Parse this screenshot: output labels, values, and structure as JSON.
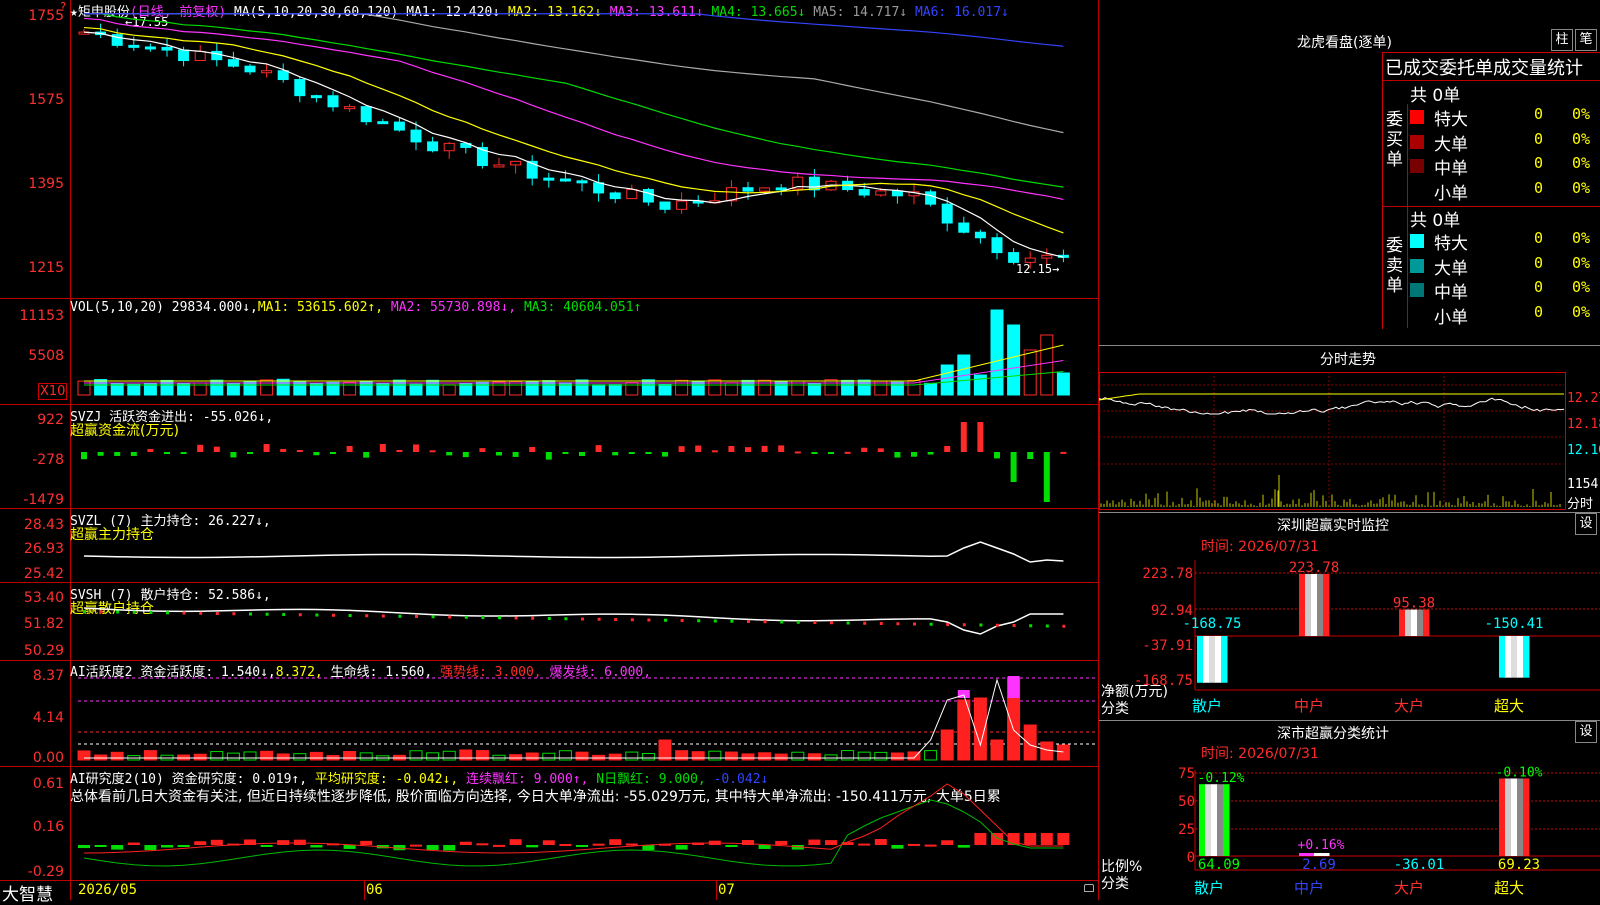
{
  "main_chart": {
    "marker": "?",
    "title_star": "★",
    "stock_name": "矩申股份",
    "period": "(日线, 前复权)",
    "ma_header": "MA(5,10,20,30,60,120)",
    "ma1": "MA1: 12.420↓",
    "ma2": "MA2: 13.162↓",
    "ma3": "MA3: 13.611↓",
    "ma4": "MA4: 13.665↓",
    "ma5": "MA5: 14.717↓",
    "ma6": "MA6: 16.017↓",
    "y_labels": [
      "1755",
      "1575",
      "1395",
      "1215"
    ],
    "high_label": "←17.55",
    "low_label": "12.15→",
    "colors": {
      "up": "#ff2a2a",
      "down": "#00ffff",
      "ma1": "#ffffff",
      "ma2": "#ffff00",
      "ma3": "#ff33ff",
      "ma4": "#00dd00",
      "ma5": "#aaaaaa",
      "ma6": "#3344ff"
    }
  },
  "vol_panel": {
    "header": "VOL(5,10,20)",
    "value": "29834.000↓,",
    "ma1": "MA1: 53615.602↑,",
    "ma2": "MA2: 55730.898↓,",
    "ma3": "MA3: 40604.051↑",
    "y_labels": [
      "11153",
      "5508"
    ],
    "unit": "X10"
  },
  "svzj_panel": {
    "header": "SVZJ",
    "line1": "活跃资金进出: -55.026↓,",
    "line2": "超赢资金流(万元)",
    "y_labels": [
      "922",
      "-278",
      "-1479"
    ]
  },
  "svzl_panel": {
    "header": "SVZL (7)",
    "line1": "主力持仓: 26.227↓,",
    "line2": "超赢主力持仓",
    "y_labels": [
      "28.43",
      "26.93",
      "25.42"
    ]
  },
  "svsh_panel": {
    "header": "SVSH (7)",
    "line1": "散户持仓: 52.586↓,",
    "line2": "超赢散户持仓",
    "y_labels": [
      "53.40",
      "51.82",
      "50.29"
    ]
  },
  "ai_activity": {
    "header": "AI活跃度2",
    "a": "资金活跃度: 1.540↓,",
    "b": "8.372,",
    "c": "生命线: 1.560,",
    "d": "强势线: 3.000,",
    "e": "爆发线: 6.000,",
    "y_labels": [
      "8.37",
      "4.14",
      "0.00"
    ]
  },
  "ai_research": {
    "header": "AI研究度2(10)",
    "a": "资金研究度: 0.019↑,",
    "b": "平均研究度: -0.042↓,",
    "c": "连续飘红: 9.000↑,",
    "d": "N日飘红: 9.000,",
    "e": "-0.042↓",
    "summary": "总体看前几日大资金有关注, 但近日持续性逐步降低, 股价面临方向选择, 今日大单净流出: -55.029万元, 其中特大单净流出: -150.411万元, 大单5日累",
    "y_labels": [
      "0.61",
      "0.16",
      "-0.29"
    ]
  },
  "footer": {
    "brand": "大智慧",
    "dates": [
      "2026/05",
      "06",
      "07"
    ]
  },
  "longhu": {
    "title": "龙虎看盘(逐单)",
    "btn1": "柱",
    "btn2": "笔",
    "subtitle": "已成交委托单成交量统计",
    "buy_label": "委买单",
    "sell_label": "委卖单",
    "buy_total": "共 0单",
    "sell_total": "共 0单",
    "buy_rows": [
      {
        "name": "特大",
        "count": "0",
        "pct": "0%",
        "color": "#ff0000"
      },
      {
        "name": "大单",
        "count": "0",
        "pct": "0%",
        "color": "#aa0000"
      },
      {
        "name": "中单",
        "count": "0",
        "pct": "0%",
        "color": "#770000"
      },
      {
        "name": "小单",
        "count": "0",
        "pct": "0%",
        "color": "#000000"
      }
    ],
    "sell_rows": [
      {
        "name": "特大",
        "count": "0",
        "pct": "0%",
        "color": "#00ffff"
      },
      {
        "name": "大单",
        "count": "0",
        "pct": "0%",
        "color": "#009999"
      },
      {
        "name": "中单",
        "count": "0",
        "pct": "0%",
        "color": "#007777"
      },
      {
        "name": "小单",
        "count": "0",
        "pct": "0%",
        "color": "#000000"
      }
    ]
  },
  "intraday": {
    "title": "分时走势",
    "y_labels": [
      "12.27",
      "12.18",
      "12.10",
      "1154",
      "分时"
    ]
  },
  "sz_monitor": {
    "title": "深圳超赢实时监控",
    "btn": "设",
    "time": "时间: 2026/07/31",
    "y_labels": [
      "223.78",
      "92.94",
      "-37.91",
      "-168.75"
    ],
    "y_caption": "净额(万元)",
    "x_caption": "分类",
    "categories": [
      "散户",
      "中户",
      "大户",
      "超大"
    ],
    "values": [
      -168.75,
      223.78,
      95.38,
      -150.41
    ],
    "value_labels": [
      "-168.75",
      "223.78",
      "95.38",
      "-150.41"
    ]
  },
  "sz_class": {
    "title": "深市超赢分类统计",
    "btn": "设",
    "time": "时间: 2026/07/31",
    "y_labels": [
      "75",
      "50",
      "25",
      "0"
    ],
    "y_caption": "比例%",
    "x_caption": "分类",
    "categories": [
      "散户",
      "中户",
      "大户",
      "超大"
    ],
    "values": [
      64.09,
      2.69,
      -36.01,
      69.23
    ],
    "value_labels": [
      "64.09",
      "2.69",
      "-36.01",
      "69.23"
    ],
    "change_labels": [
      "-0.12%",
      "+0.16%",
      "",
      "-0.10%"
    ]
  }
}
